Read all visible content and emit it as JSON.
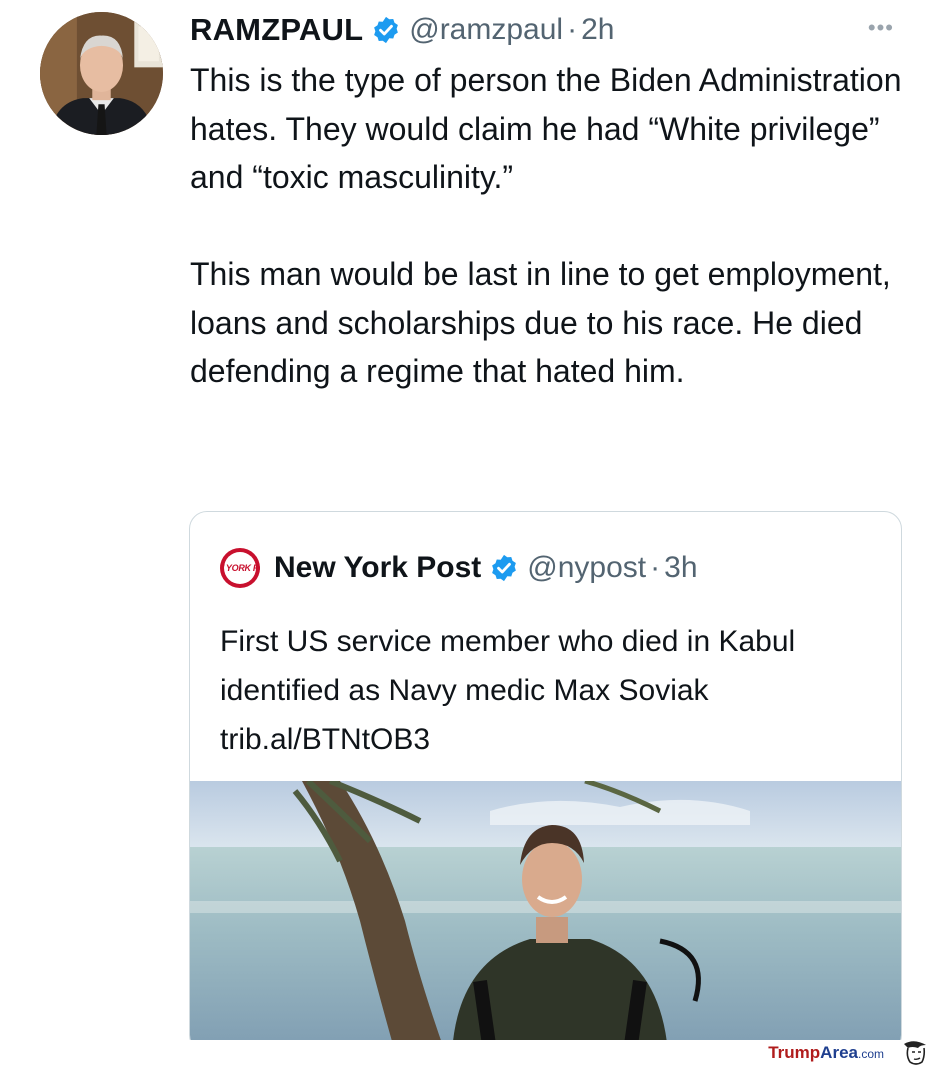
{
  "tweet": {
    "display_name": "RAMZPAUL",
    "handle": "@ramzpaul",
    "separator": "·",
    "time": "2h",
    "more_label": "•••",
    "paragraphs": [
      "This is the type of person the Biden Administration hates. They would claim he had “White privilege” and “toxic masculinity.”",
      "This man would be last in line to get employment, loans and scholarships due to his race. He died defending a regime that hated him."
    ]
  },
  "quoted_tweet": {
    "logo_text": "NEW YORK POST",
    "display_name": "New York Post",
    "handle": "@nypost",
    "separator": "·",
    "time": "3h",
    "text": "First US service member who died in Kabul identified as Navy medic Max Soviak trib.al/BTNtOB3"
  },
  "watermark": {
    "part1": "Trump",
    "part2": "Area",
    "part3": ".com"
  },
  "colors": {
    "verified_blue": "#1d9bf0",
    "secondary_text": "#536471",
    "nypost_red": "#c8102e",
    "border": "#cfd9de"
  },
  "icons": {
    "verified": "verified-badge-icon",
    "more": "more-icon"
  }
}
